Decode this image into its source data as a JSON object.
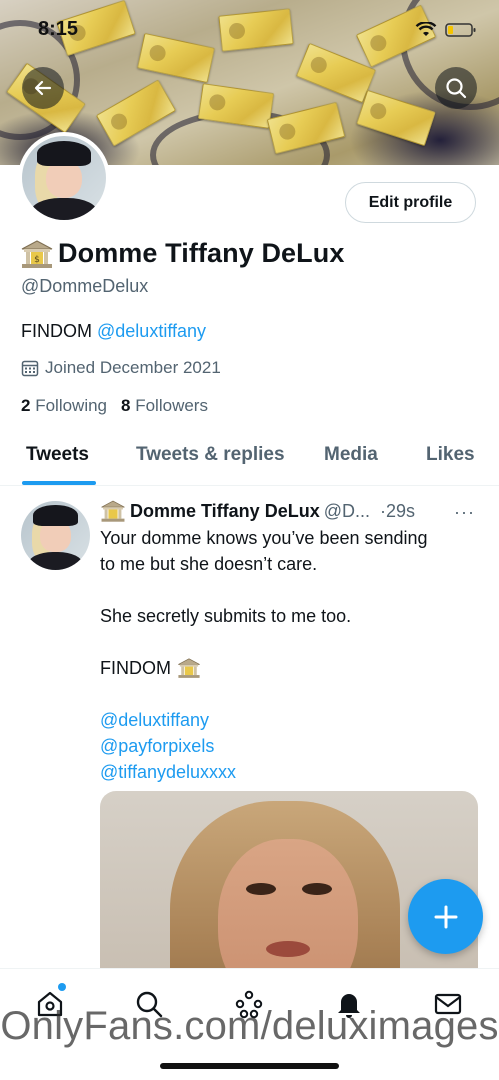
{
  "status_bar": {
    "time": "8:15"
  },
  "profile": {
    "display_name": "Domme Tiffany DeLux",
    "handle": "@DommeDelux",
    "bio_text": "FINDOM",
    "bio_link": "@deluxtiffany",
    "joined": "Joined December 2021",
    "following_count": "2",
    "following_label": "Following",
    "followers_count": "8",
    "followers_label": "Followers",
    "edit_button": "Edit profile"
  },
  "tabs": [
    {
      "label": "Tweets"
    },
    {
      "label": "Tweets & replies"
    },
    {
      "label": "Media"
    },
    {
      "label": "Likes"
    }
  ],
  "tweet": {
    "name": "Domme Tiffany DeLux",
    "handle": "@D...",
    "time": "·29s",
    "more": "···",
    "lines": [
      "Your domme knows you’ve been sending",
      "to me but she doesn’t care.",
      "She secretly submits to me too.",
      "FINDOM"
    ],
    "links": [
      "@deluxtiffany",
      "@payforpixels",
      "@tiffanydeluxxxx"
    ]
  },
  "watermark": "OnlyFans.com/deluximages",
  "colors": {
    "accent": "#1d9bf0",
    "text": "#0f1419",
    "muted": "#536471"
  },
  "icons": {
    "back": "arrow-left-icon",
    "search": "search-icon",
    "bank": "bank-icon",
    "calendar": "calendar-icon",
    "compose": "plus-icon",
    "nav": [
      "home-icon",
      "search-icon",
      "spaces-icon",
      "bell-icon",
      "mail-icon"
    ]
  }
}
